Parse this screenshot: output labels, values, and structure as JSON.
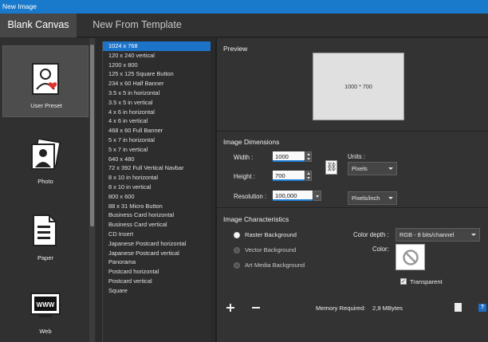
{
  "window": {
    "title": "New Image"
  },
  "tabs": [
    {
      "label": "Blank Canvas",
      "active": true
    },
    {
      "label": "New From Template",
      "active": false
    }
  ],
  "categories": [
    {
      "label": "User Preset",
      "icon": "user-preset-icon",
      "selected": true
    },
    {
      "label": "Photo",
      "icon": "photo-icon",
      "selected": false
    },
    {
      "label": "Paper",
      "icon": "paper-icon",
      "selected": false
    },
    {
      "label": "Web",
      "icon": "web-icon",
      "selected": false
    }
  ],
  "web_icon_text": "WWW",
  "presets": [
    "1024 x 768",
    "120 x 240 vertical",
    "1200 x 800",
    "125 x 125 Square Button",
    "234 x 60 Half Banner",
    "3.5 x 5 in horizontal",
    "3.5 x 5 in vertical",
    "4 x 6 in horizontal",
    "4 x 6 in vertical",
    "468 x 60 Full Banner",
    "5 x 7 in horizontal",
    "5 x 7 in vertical",
    "640 x 480",
    "72 x 392 Full Vertical Navbar",
    "8 x 10 in horizontal",
    "8 x 10 in vertical",
    "800 x 600",
    "88 x 31 Micro Button",
    "Business Card horizontal",
    "Business Card vertical",
    "CD Insert",
    "Japanese Postcard horizontal",
    "Japanese Postcard vertical",
    "Panorama",
    "Postcard horizontal",
    "Postcard vertical",
    "Square"
  ],
  "selected_preset_index": 0,
  "preview": {
    "heading": "Preview",
    "caption": "1000 * 700"
  },
  "dimensions": {
    "heading": "Image Dimensions",
    "width_label": "Width :",
    "width_value": "1000",
    "height_label": "Height :",
    "height_value": "700",
    "resolution_label": "Resolution :",
    "resolution_value": "100,000",
    "units_label": "Units :",
    "units_value": "Pixels",
    "res_units_value": "Pixels/inch"
  },
  "characteristics": {
    "heading": "Image Characteristics",
    "backgrounds": [
      {
        "label": "Raster Background",
        "selected": true
      },
      {
        "label": "Vector Background",
        "selected": false
      },
      {
        "label": "Art Media Background",
        "selected": false
      }
    ],
    "color_depth_label": "Color depth :",
    "color_depth_value": "RGB - 8 bits/channel",
    "color_label": "Color:",
    "transparent_label": "Transparent",
    "transparent_checked": true
  },
  "footer": {
    "memory_label": "Memory Required:",
    "memory_value": "2,9 MBytes",
    "add_icon": "plus-icon",
    "remove_icon": "minus-icon",
    "help_text": "?"
  },
  "colors": {
    "titlebar": "#1979ca",
    "selection": "#1c73c8",
    "input_underline": "#1d7fd6"
  }
}
